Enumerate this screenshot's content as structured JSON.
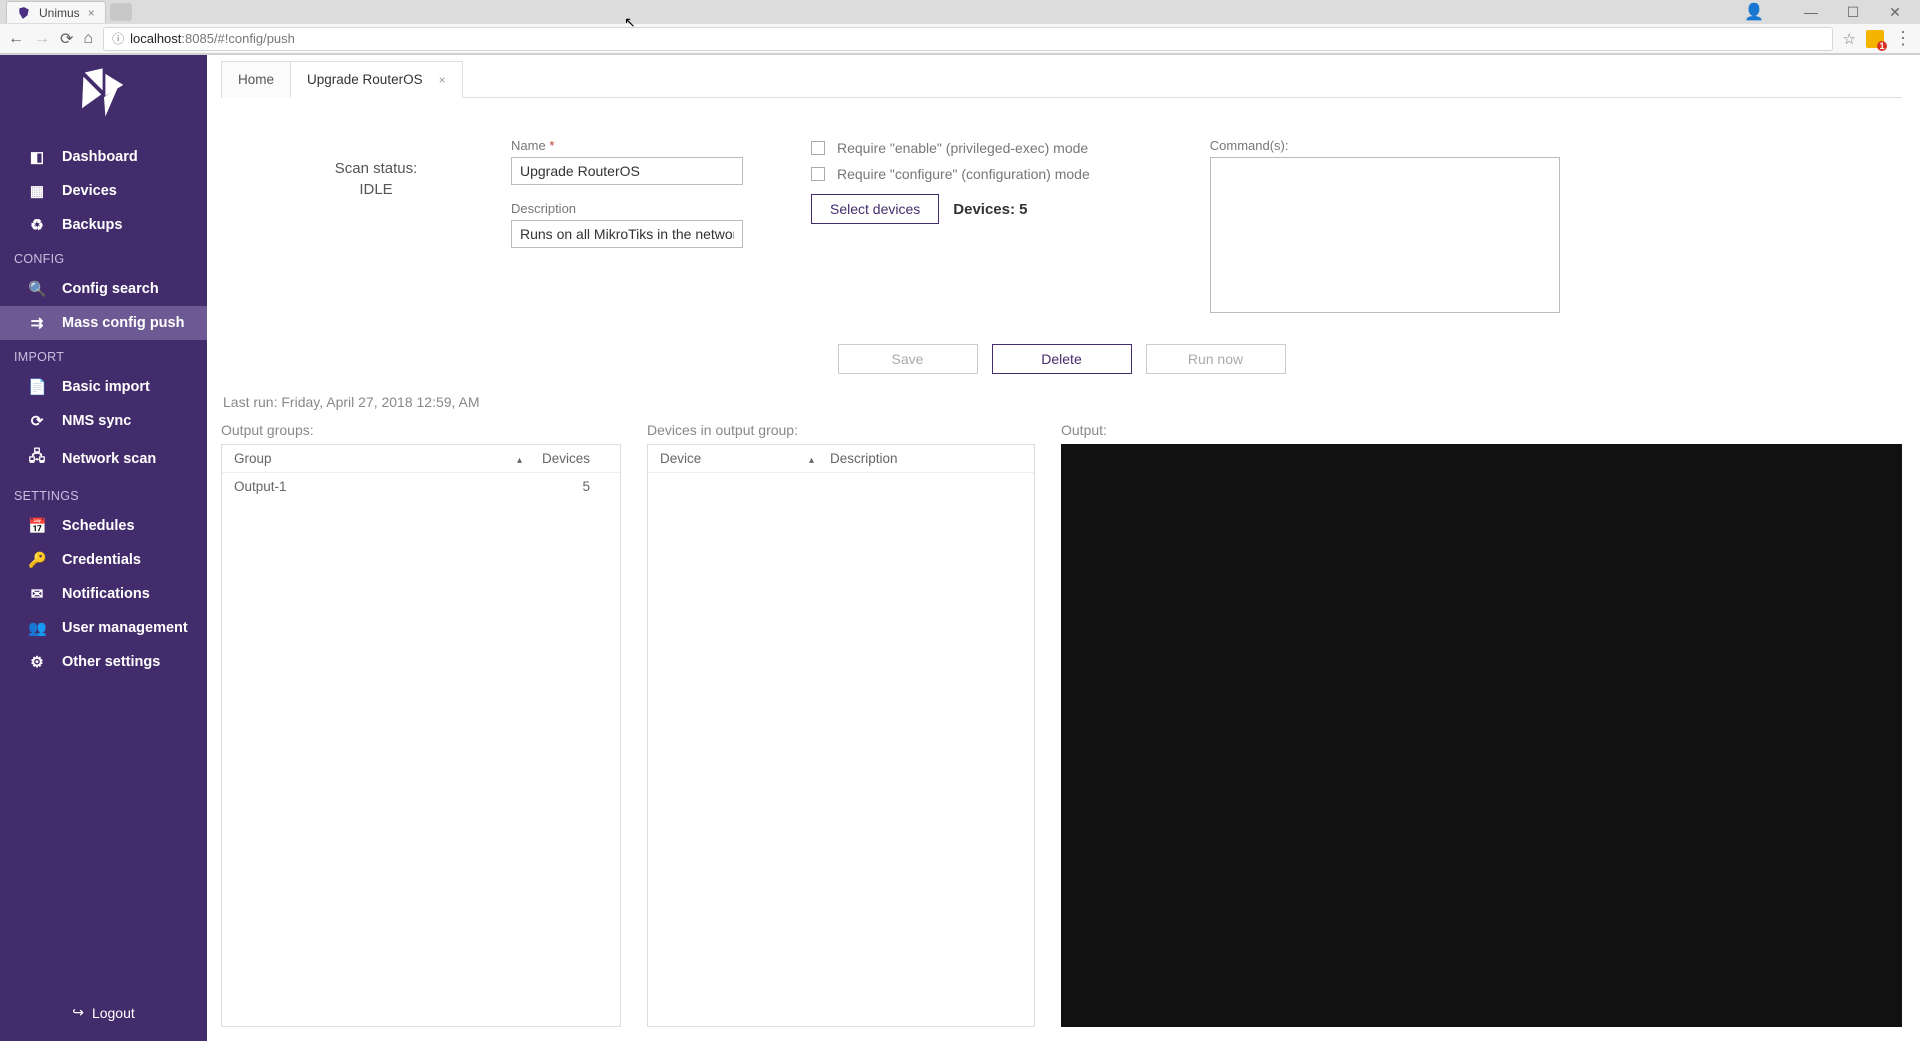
{
  "browser": {
    "tab_title": "Unimus",
    "url_host": "localhost",
    "url_rest": ":8085/#!config/push"
  },
  "sidebar": {
    "items": [
      {
        "label": "Dashboard",
        "icon": "◧"
      },
      {
        "label": "Devices",
        "icon": "▦"
      },
      {
        "label": "Backups",
        "icon": "♻"
      }
    ],
    "section_config": "CONFIG",
    "config_items": [
      {
        "label": "Config search",
        "icon": "🔍"
      },
      {
        "label": "Mass config push",
        "icon": "⇉"
      }
    ],
    "section_import": "IMPORT",
    "import_items": [
      {
        "label": "Basic import",
        "icon": "📄"
      },
      {
        "label": "NMS sync",
        "icon": "⟳"
      },
      {
        "label": "Network scan",
        "icon": "🖧"
      }
    ],
    "section_settings": "SETTINGS",
    "settings_items": [
      {
        "label": "Schedules",
        "icon": "📅"
      },
      {
        "label": "Credentials",
        "icon": "🔑"
      },
      {
        "label": "Notifications",
        "icon": "✉"
      },
      {
        "label": "User management",
        "icon": "👥"
      },
      {
        "label": "Other settings",
        "icon": "⚙"
      }
    ],
    "logout": "Logout"
  },
  "page_tabs": {
    "home": "Home",
    "active": "Upgrade RouterOS"
  },
  "form": {
    "scan_status_label": "Scan status:",
    "scan_status_value": "IDLE",
    "name_label": "Name",
    "name_value": "Upgrade RouterOS",
    "desc_label": "Description",
    "desc_value": "Runs on all MikroTiks in the network",
    "enable_mode": "Require \"enable\" (privileged-exec) mode",
    "configure_mode": "Require \"configure\" (configuration) mode",
    "select_devices": "Select devices",
    "devices_count": "Devices: 5",
    "commands_label": "Command(s):"
  },
  "actions": {
    "save": "Save",
    "delete": "Delete",
    "run": "Run now"
  },
  "last_run": "Last run: Friday, April 27, 2018 12:59, AM",
  "tables": {
    "groups_title": "Output groups:",
    "groups_cols": {
      "group": "Group",
      "devices": "Devices"
    },
    "groups_rows": [
      {
        "group": "Output-1",
        "devices": "5"
      }
    ],
    "devices_title": "Devices in output group:",
    "devices_cols": {
      "device": "Device",
      "desc": "Description"
    },
    "output_title": "Output:"
  }
}
